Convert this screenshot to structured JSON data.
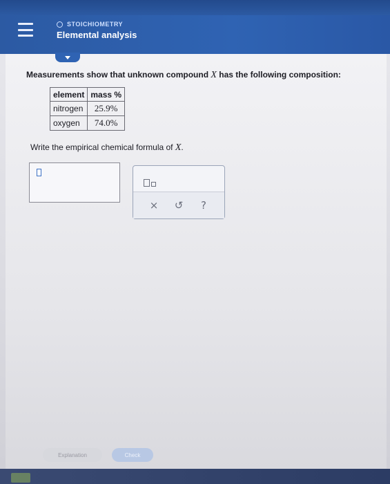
{
  "header": {
    "section_label": "STOICHIOMETRY",
    "title": "Elemental analysis"
  },
  "problem": {
    "intro_before_var": "Measurements show that unknown compound ",
    "variable": "X",
    "intro_after_var": " has the following composition:",
    "table": {
      "headers": [
        "element",
        "mass %"
      ],
      "rows": [
        [
          "nitrogen",
          "25.9%"
        ],
        [
          "oxygen",
          "74.0%"
        ]
      ]
    },
    "question_before_var": "Write the empirical chemical formula of ",
    "question_var": "X",
    "question_after_var": "."
  },
  "tools": {
    "clear_symbol": "×",
    "undo_symbol": "↺",
    "help_symbol": "?"
  },
  "footer": {
    "explanation_label": "Explanation",
    "check_label": "Check"
  },
  "colors": {
    "header_blue": "#2f63b3",
    "check_button": "#b8c8e4"
  }
}
